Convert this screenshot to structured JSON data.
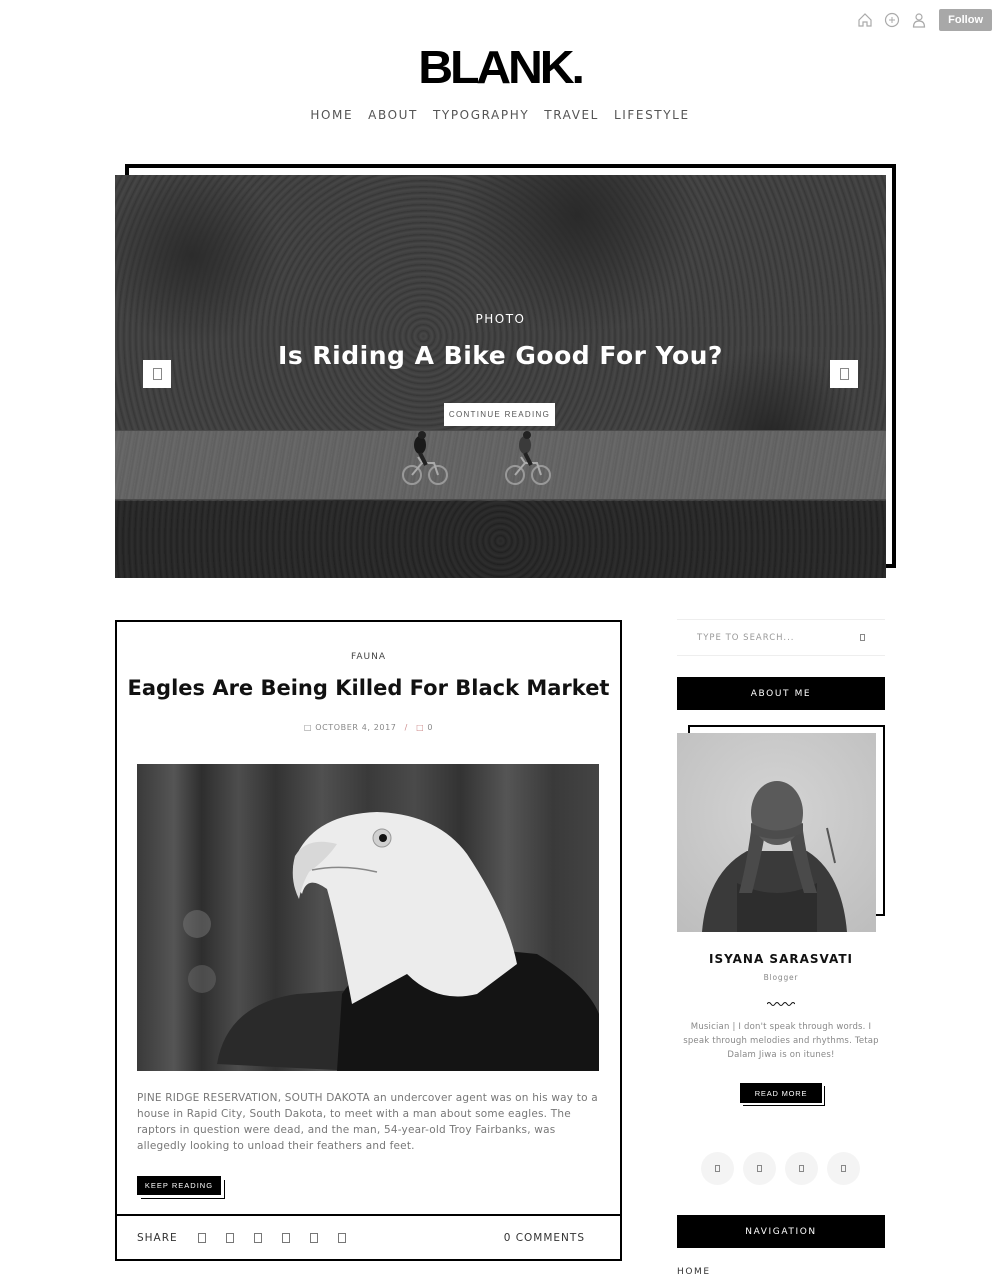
{
  "topbar": {
    "icons": [
      "home-icon",
      "add-circle-icon",
      "user-icon"
    ],
    "follow_label": "Follow"
  },
  "site": {
    "logo": "BLANK."
  },
  "nav": {
    "items": [
      {
        "label": "HOME"
      },
      {
        "label": "ABOUT"
      },
      {
        "label": "TYPOGRAPHY"
      },
      {
        "label": "TRAVEL"
      },
      {
        "label": "LIFESTYLE"
      }
    ]
  },
  "hero": {
    "category": "PHOTO",
    "title": "Is Riding A Bike Good For You?",
    "button_label": "CONTINUE READING",
    "prev_icon": "chevron-left-icon",
    "next_icon": "chevron-right-icon"
  },
  "post": {
    "category": "FAUNA",
    "title": "Eagles Are Being Killed For Black Market",
    "date": "OCTOBER 4, 2017",
    "comment_count": "0",
    "excerpt": "PINE RIDGE RESERVATION, SOUTH DAKOTA an undercover agent was on his way to a house in Rapid City, South Dakota, to meet with a man about some eagles. The raptors in question were dead, and the man, 54-year-old Troy Fairbanks, was allegedly looking to unload their feathers and feet.",
    "button_label": "KEEP READING",
    "share_label": "SHARE",
    "share_icons": [
      "facebook-icon",
      "twitter-icon",
      "google-plus-icon",
      "pinterest-icon",
      "linkedin-icon",
      "email-icon"
    ],
    "comments_label": "0 COMMENTS"
  },
  "sidebar": {
    "search_placeholder": "TYPE TO SEARCH...",
    "about_heading": "ABOUT ME",
    "about_name": "ISYANA SARASVATI",
    "about_role": "Blogger",
    "about_bio": "Musician | I don't speak through words. I speak through melodies and rhythms. Tetap Dalam Jiwa is on itunes!",
    "read_more_label": "READ MORE",
    "social_icons": [
      "facebook-icon",
      "twitter-icon",
      "instagram-icon",
      "pinterest-icon"
    ],
    "navigation_heading": "NAVIGATION",
    "navigation_items": [
      {
        "label": "HOME"
      }
    ]
  }
}
